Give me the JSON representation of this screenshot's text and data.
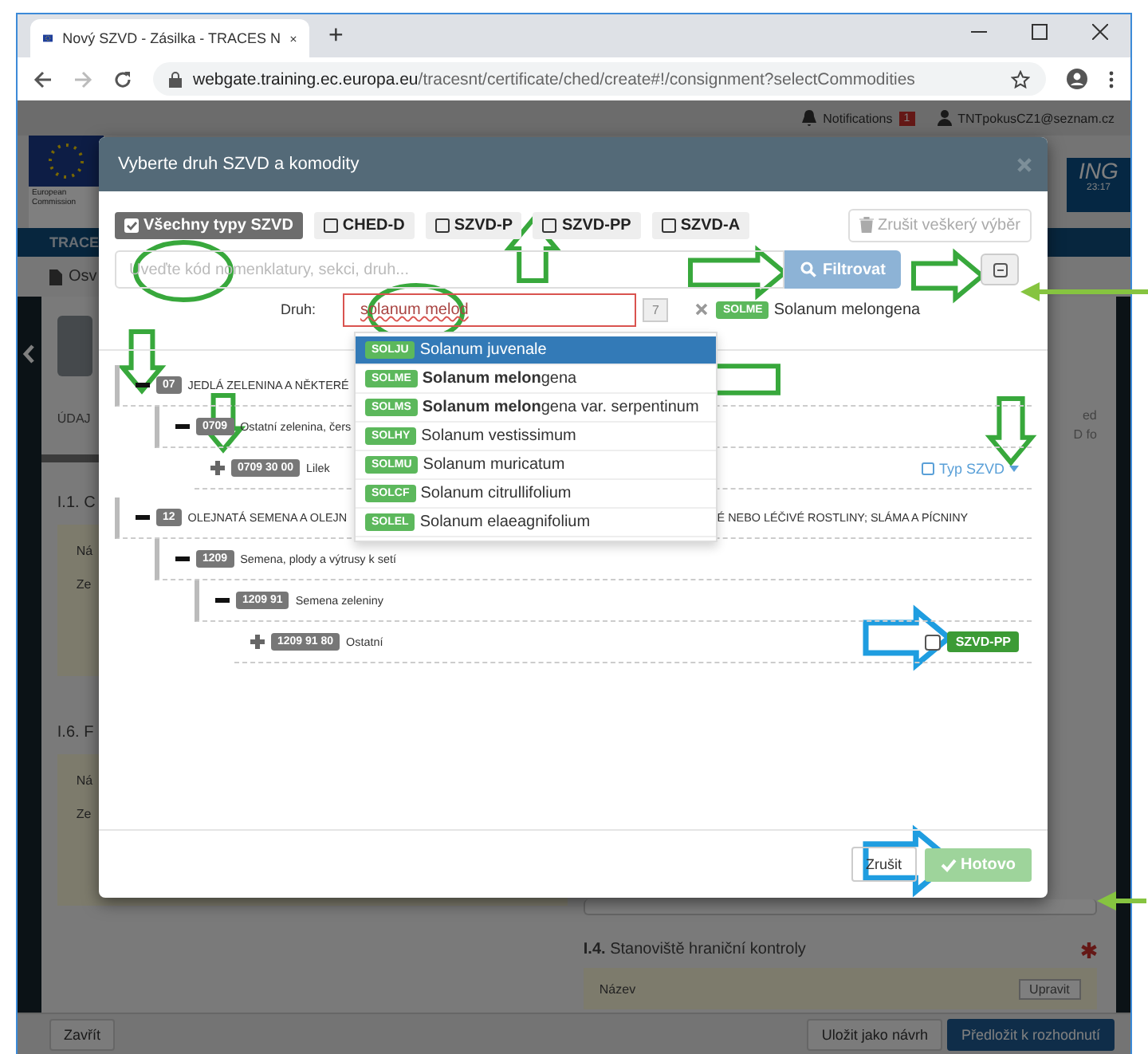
{
  "browser": {
    "tab_title": "Nový SZVD - Zásilka - TRACES N",
    "new_tab": "+",
    "url_host": "webgate.training.ec.europa.eu",
    "url_path": "/tracesnt/certificate/ched/create#!/consignment?selectCommodities"
  },
  "top_bar": {
    "notifications": "Notifications",
    "notification_count": "1",
    "user": "TNTpokusCZ1@seznam.cz"
  },
  "header": {
    "logo_text": "European Commission",
    "banner": "ING",
    "time": "23:17"
  },
  "nav": {
    "title": "TRACE"
  },
  "toolbar": {
    "button": "Osv"
  },
  "page": {
    "tab": "ÚDAJ",
    "side_lines": [
      "ed",
      "D fo"
    ],
    "sections": [
      {
        "title": "I.1. C",
        "fields": [
          "Ná",
          "Ze"
        ]
      },
      {
        "title": "I.6. F",
        "fields": [
          "Ná",
          "Ze"
        ]
      }
    ],
    "border_post": {
      "number": "I.4.",
      "title": "Stanoviště hraniční kontroly",
      "field": "Název",
      "edit": "Upravit"
    }
  },
  "bottom_bar": {
    "close": "Zavřít",
    "save": "Uložit jako návrh",
    "submit": "Předložit k rozhodnutí"
  },
  "modal": {
    "title": "Vyberte druh SZVD a komodity",
    "filters": [
      {
        "label": "Všechny typy SZVD",
        "checked": true
      },
      {
        "label": "CHED-D",
        "checked": false
      },
      {
        "label": "SZVD-P",
        "checked": false
      },
      {
        "label": "SZVD-PP",
        "checked": false
      },
      {
        "label": "SZVD-A",
        "checked": false
      }
    ],
    "clear_button": {
      "label": "Zrušit veškerý výběr",
      "disabled": true
    },
    "search": {
      "placeholder": "Uveďte kód nomenklatury, sekci, druh..."
    },
    "filter_button": "Filtrovat",
    "species": {
      "label": "Druh:",
      "value": "solanum melod",
      "count": "7",
      "chip_code": "SOLME",
      "chip_name": "Solanum melongena"
    },
    "suggestions": [
      {
        "code": "SOLJU",
        "name": "Solanum juvenale",
        "selected": true
      },
      {
        "code": "SOLME",
        "name": "**Solanum melon**gena",
        "selected": false
      },
      {
        "code": "SOLMS",
        "name": "**Solanum melon**gena var. serpentinum",
        "selected": false
      },
      {
        "code": "SOLHY",
        "name": "Solanum vestissimum",
        "selected": false
      },
      {
        "code": "SOLMU",
        "name": "Solanum muricatum",
        "selected": false
      },
      {
        "code": "SOLCF",
        "name": "Solanum citrullifolium",
        "selected": false
      },
      {
        "code": "SOLEL",
        "name": "Solanum elaeagnifolium",
        "selected": false
      }
    ],
    "tree": [
      {
        "code": "07",
        "label": "JEDLÁ ZELENINA A NĚKTERÉ",
        "expanded": true,
        "children": [
          {
            "code": "0709",
            "label": "Ostatní zelenina, čers",
            "expanded": true,
            "children": [
              {
                "code": "0709 30 00",
                "label": "Lilek",
                "expanded": false,
                "type_filter": "Typ SZVD"
              }
            ]
          }
        ]
      },
      {
        "code": "12",
        "label": "OLEJNATÁ SEMENA A OLEJN",
        "label_tail": "É NEBO LÉČIVÉ ROSTLINY; SLÁMA A PÍCNINY",
        "expanded": true,
        "children": [
          {
            "code": "1209",
            "label": "Semena, plody a výtrusy k setí",
            "expanded": true,
            "children": [
              {
                "code": "1209 91",
                "label": "Semena zeleniny",
                "expanded": true,
                "children": [
                  {
                    "code": "1209 91 80",
                    "label": "Ostatní",
                    "expanded": false,
                    "checked": false,
                    "tag": "SZVD-PP"
                  }
                ]
              }
            ]
          }
        ]
      }
    ],
    "footer": {
      "cancel": "Zrušit",
      "done": {
        "label": "Hotovo",
        "disabled": true
      }
    }
  }
}
